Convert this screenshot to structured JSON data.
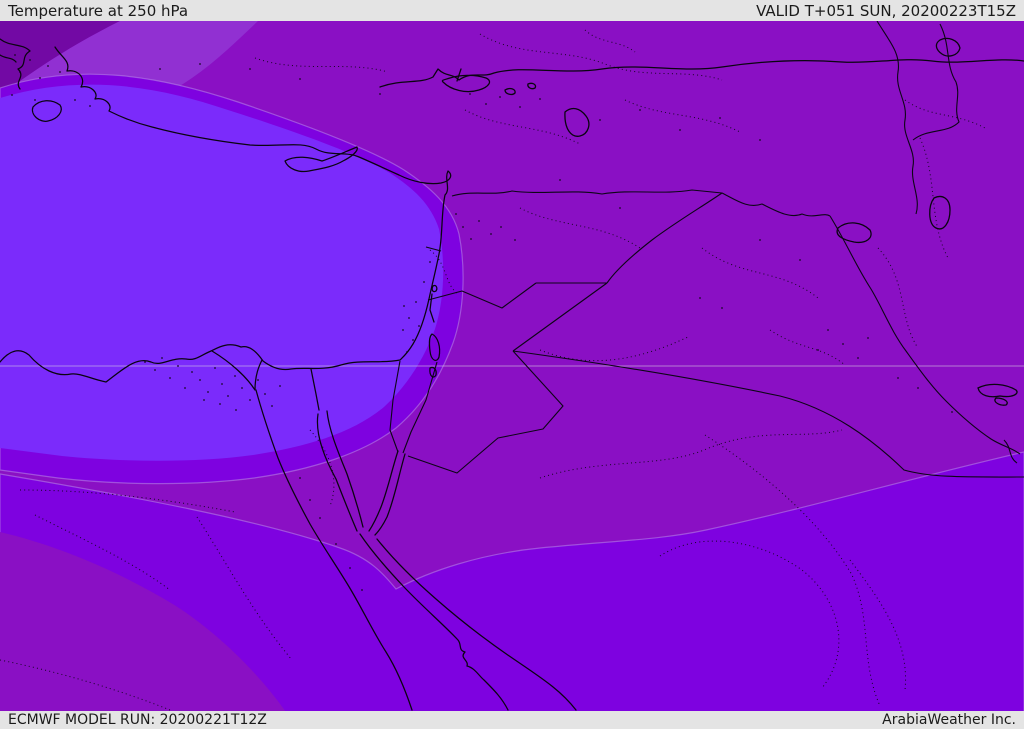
{
  "header": {
    "title": "Temperature at 250 hPa",
    "valid": "VALID T+051 SUN, 20200223T15Z"
  },
  "footer": {
    "model_run": "ECMWF MODEL RUN: 20200221T12Z",
    "brand": "ArabiaWeather Inc."
  },
  "map": {
    "region": "Middle East / Eastern Mediterranean",
    "palette": {
      "base": "#8a10c4",
      "bright": "#7e02e0",
      "coldest_blob": "#7b2bfb",
      "nw_band": "#9130d2",
      "nw_dark": "#7209a4",
      "bar_bg": "#e4e4e4",
      "line_black": "#0a0410"
    }
  }
}
